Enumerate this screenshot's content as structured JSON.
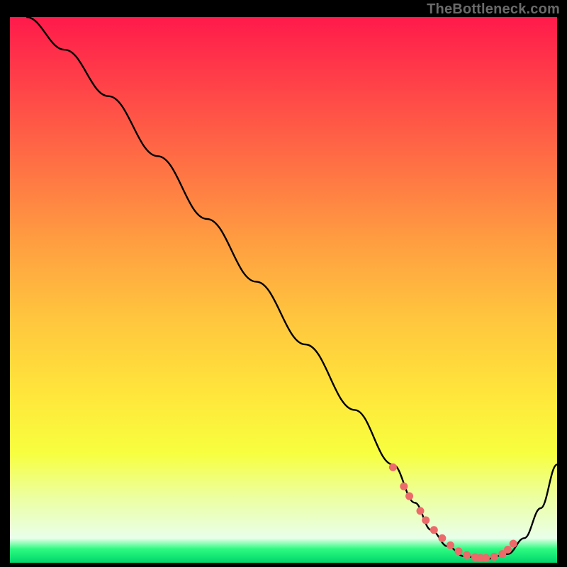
{
  "watermark": "TheBottleneck.com",
  "chart_data": {
    "type": "line",
    "title": "",
    "xlabel": "",
    "ylabel": "",
    "xlim": [
      0,
      100
    ],
    "ylim": [
      0,
      100
    ],
    "gradient_stops": [
      {
        "offset": 0.0,
        "color": "#ff1a4b"
      },
      {
        "offset": 0.1,
        "color": "#ff3a49"
      },
      {
        "offset": 0.25,
        "color": "#ff6a45"
      },
      {
        "offset": 0.4,
        "color": "#ff9a41"
      },
      {
        "offset": 0.55,
        "color": "#ffc53e"
      },
      {
        "offset": 0.7,
        "color": "#ffe83b"
      },
      {
        "offset": 0.8,
        "color": "#f7ff3f"
      },
      {
        "offset": 0.88,
        "color": "#ecffa0"
      },
      {
        "offset": 0.955,
        "color": "#e9ffe9"
      },
      {
        "offset": 0.975,
        "color": "#2dfa80"
      },
      {
        "offset": 1.0,
        "color": "#00d66b"
      }
    ],
    "series": [
      {
        "name": "curve",
        "color": "#000000",
        "x": [
          3,
          10,
          18,
          27,
          36,
          45,
          54,
          63,
          70,
          74,
          77,
          80,
          83,
          87,
          91,
          94,
          97,
          100
        ],
        "y": [
          100,
          94,
          85.5,
          74.5,
          63,
          51.5,
          40,
          28,
          18,
          11,
          6,
          3,
          1.2,
          0.7,
          1.6,
          4.5,
          10,
          18
        ]
      }
    ],
    "markers": {
      "name": "highlight-dots",
      "color": "#ed6a6a",
      "x": [
        70,
        72,
        73,
        75,
        76,
        77.5,
        79,
        80.5,
        82,
        83.5,
        85,
        86,
        87,
        88.5,
        90,
        91,
        92
      ],
      "y": [
        17.5,
        14,
        12.2,
        9.5,
        7.8,
        6,
        4.5,
        3.2,
        2.1,
        1.4,
        1.0,
        0.9,
        0.9,
        1.1,
        1.6,
        2.4,
        3.5
      ]
    }
  }
}
